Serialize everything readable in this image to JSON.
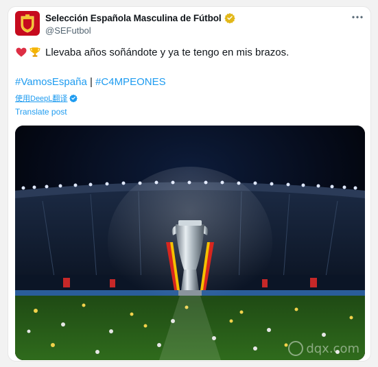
{
  "account": {
    "name": "Selección Española Masculina de Fútbol",
    "handle": "@SEFutbol"
  },
  "menu_icon": "more-horizontal-icon",
  "post": {
    "text": "Llevaba años soñándote y ya te tengo en mis brazos.",
    "emojis": [
      "red-heart",
      "trophy"
    ],
    "hashtag1": "#VamosEspaña",
    "separator": "|",
    "hashtag2": "#C4MPEONES",
    "deepl_label": "使用DeepL翻译",
    "translate_label": "Translate post"
  },
  "watermark": {
    "text": "dqx.com"
  },
  "colors": {
    "link": "#1d9bf0",
    "verified": "#e2b719",
    "brand_red": "#c60b1e"
  }
}
